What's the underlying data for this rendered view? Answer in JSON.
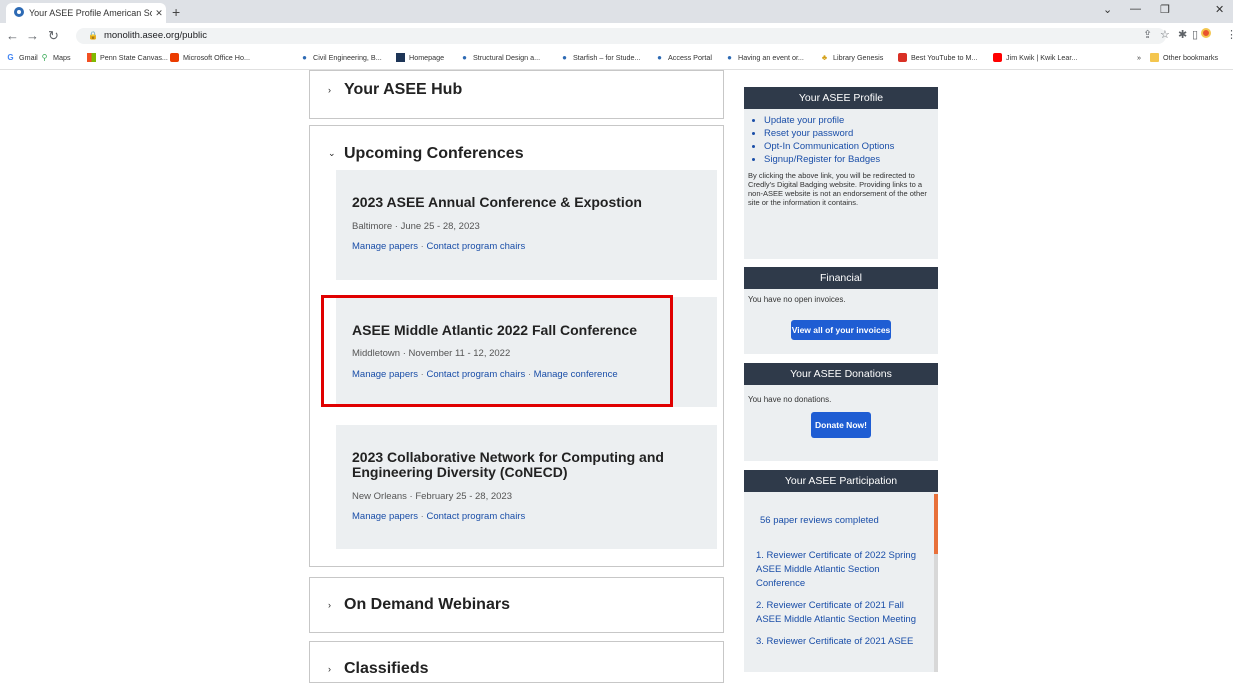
{
  "browser": {
    "tab_title": "Your ASEE Profile American Socie",
    "url": "monolith.asee.org/public",
    "bookmarks": [
      "Gmail",
      "Maps",
      "Penn State Canvas...",
      "Microsoft Office Ho...",
      "Civil Engineering, B...",
      "Homepage",
      "Structural Design a...",
      "Starfish – for Stude...",
      "Access Portal",
      "Having an event or...",
      "Library Genesis",
      "Best YouTube to M...",
      "Jim Kwik | Kwik Lear..."
    ],
    "other_bookmarks": "Other bookmarks",
    "overflow": "»"
  },
  "sections": {
    "hub": "Your ASEE Hub",
    "upcoming": "Upcoming Conferences",
    "webinars": "On Demand Webinars",
    "classifieds": "Classifieds"
  },
  "conferences": [
    {
      "name": "2023 ASEE Annual Conference & Expostion",
      "meta": "Baltimore · June 25 - 28, 2023",
      "link1": "Manage papers",
      "link2": "Contact program chairs"
    },
    {
      "name": "ASEE Middle Atlantic 2022 Fall Conference",
      "meta": "Middletown · November 11 - 12, 2022",
      "link1": "Manage papers",
      "link2": "Contact program chairs",
      "link3": "Manage conference"
    },
    {
      "name": "2023 Collaborative Network for Computing and Engineering Diversity (CoNECD)",
      "meta": "New Orleans · February 25 - 28, 2023",
      "link1": "Manage papers",
      "link2": "Contact program chairs"
    }
  ],
  "profile": {
    "header": "Your ASEE Profile",
    "links": [
      "Update your profile",
      "Reset your password",
      "Opt-In Communication Options",
      "Signup/Register for Badges"
    ],
    "note": "By clicking the above link, you will be redirected to Credly's Digital Badging website. Providing links to a non-ASEE website is not an endorsement of the other site or the information it contains."
  },
  "financial": {
    "header": "Financial",
    "text": "You have no open invoices.",
    "button": "View all of your invoices"
  },
  "donations": {
    "header": "Your ASEE Donations",
    "text": "You have no donations.",
    "button": "Donate Now!"
  },
  "participation": {
    "header": "Your ASEE Participation",
    "reviews": "56 paper reviews completed",
    "certs": [
      "1. Reviewer Certificate of 2022 Spring ASEE Middle Atlantic Section Conference",
      "2. Reviewer Certificate of 2021 Fall ASEE Middle Atlantic Section Meeting",
      "3. Reviewer Certificate of 2021 ASEE"
    ]
  }
}
